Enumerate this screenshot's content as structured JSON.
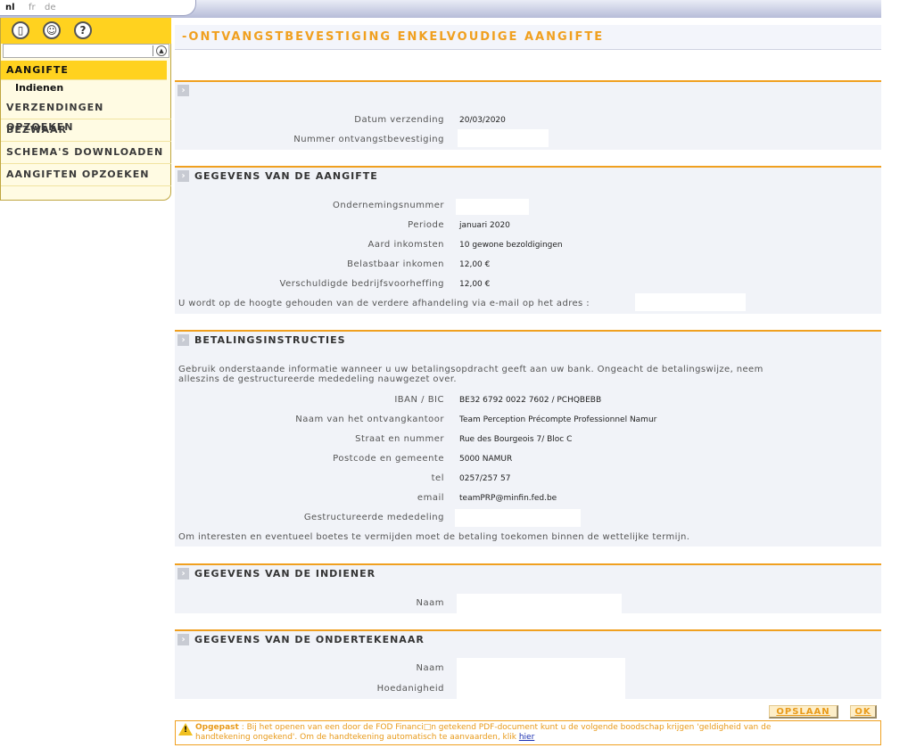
{
  "languages": [
    "nl",
    "fr",
    "de"
  ],
  "sidebar": {
    "items": [
      {
        "label": "AANGIFTE"
      },
      {
        "label": "Indienen"
      },
      {
        "label": "VERZENDINGEN OPZOEKEN"
      },
      {
        "label": "BEZWAAR"
      },
      {
        "label": "SCHEMA'S DOWNLOADEN"
      },
      {
        "label": "AANGIFTEN OPZOEKEN"
      }
    ]
  },
  "header": {
    "title": "-ONTVANGSTBEVESTIGING ENKELVOUDIGE AANGIFTE"
  },
  "verzending": {
    "datum_label": "Datum verzending",
    "datum_value": "20/03/2020",
    "nummer_label": "Nummer ontvangstbevestiging"
  },
  "aangifte": {
    "title": "GEGEVENS VAN DE AANGIFTE",
    "ondernemingsnummer_label": "Ondernemingsnummer",
    "periode_label": "Periode",
    "periode_value": "januari   2020",
    "aard_label": "Aard inkomsten",
    "aard_value": "10 gewone bezoldigingen",
    "belastbaar_label": "Belastbaar inkomen",
    "belastbaar_value": "12,00 €",
    "verschuldigde_label": "Verschuldigde bedrijfsvoorheffing",
    "verschuldigde_value": "12,00 €",
    "email_note": "U wordt op de hoogte gehouden van de verdere afhandeling via e-mail op het adres :"
  },
  "betaling": {
    "title": "BETALINGSINSTRUCTIES",
    "intro_line1": "Gebruik onderstaande informatie wanneer u uw betalingsopdracht geeft aan uw bank. Ongeacht de betalingswijze, neem",
    "intro_line2": "alleszins de gestructureerde mededeling nauwgezet over.",
    "iban_label": "IBAN / BIC",
    "iban_value": "BE32 6792 0022 7602 / PCHQBEBB",
    "kantoor_label": "Naam van het ontvangkantoor",
    "kantoor_value": "Team Perception Précompte Professionnel Namur",
    "straat_label": "Straat en nummer",
    "straat_value": "Rue des Bourgeois 7/ Bloc C",
    "postcode_label": "Postcode en gemeente",
    "postcode_value": "5000 NAMUR",
    "tel_label": "tel",
    "tel_value": "0257/257 57",
    "email_label": "email",
    "email_value": "teamPRP@minfin.fed.be",
    "mededeling_label": "Gestructureerde mededeling",
    "footer_note": "Om interesten en eventueel boetes te vermijden moet de betaling toekomen binnen de wettelijke termijn."
  },
  "indiener": {
    "title": "GEGEVENS VAN DE INDIENER",
    "naam_label": "Naam"
  },
  "ondertekenaar": {
    "title": "GEGEVENS VAN DE ONDERTEKENAAR",
    "naam_label": "Naam",
    "hoedanigheid_label": "Hoedanigheid"
  },
  "buttons": {
    "save": "OPSLAAN",
    "ok": "OK"
  },
  "warning": {
    "bold": "Opgepast",
    "text1": " : Bij het openen van een door de FOD Financi□n getekend PDF-document kunt u de volgende boodschap krijgen 'geldigheid van de",
    "text2": "handtekening ongekend'. Om de handtekening automatisch te aanvaarden, klik ",
    "link": "hier"
  },
  "colors": {
    "accent": "#f0a020",
    "nav_yellow": "#ffd21f",
    "section_bg": "#f1f3f8"
  }
}
